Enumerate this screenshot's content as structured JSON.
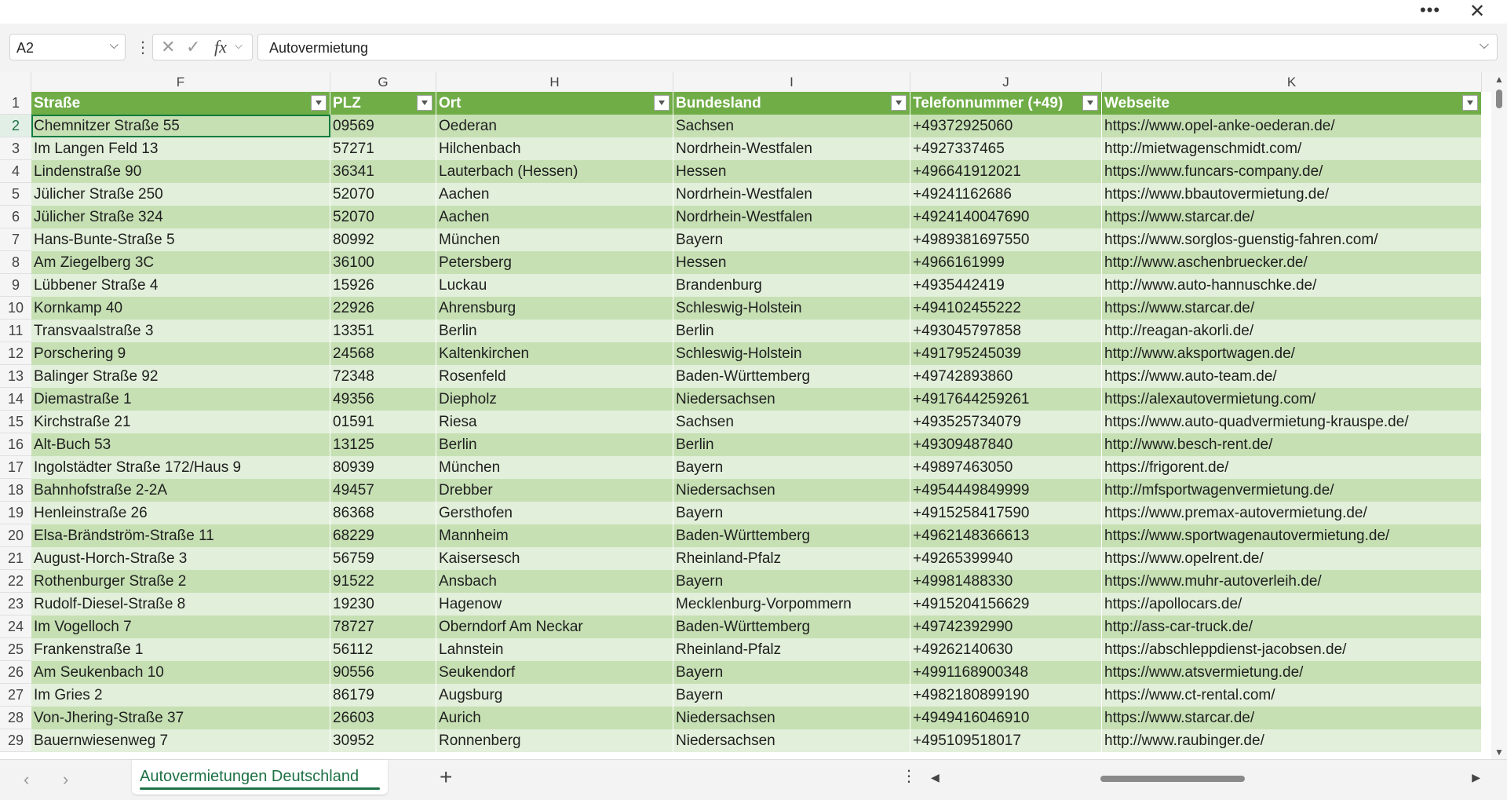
{
  "window": {
    "more_label": "•••",
    "close_label": "✕"
  },
  "formula_bar": {
    "name_box": "A2",
    "separator": "⋮",
    "cancel_icon": "✕",
    "enter_icon": "✓",
    "fx_label": "fx",
    "content": "Autovermietung"
  },
  "columns": [
    {
      "letter": "F",
      "header": "Straße"
    },
    {
      "letter": "G",
      "header": "PLZ"
    },
    {
      "letter": "H",
      "header": "Ort"
    },
    {
      "letter": "I",
      "header": "Bundesland"
    },
    {
      "letter": "J",
      "header": "Telefonnummer (+49)"
    },
    {
      "letter": "K",
      "header": "Webseite"
    }
  ],
  "header_row_number": "1",
  "rows": [
    {
      "n": "2",
      "cells": [
        "Chemnitzer Straße 55",
        "09569",
        "Oederan",
        "Sachsen",
        "+49372925060",
        "https://www.opel-anke-oederan.de/"
      ]
    },
    {
      "n": "3",
      "cells": [
        "Im Langen Feld 13",
        "57271",
        "Hilchenbach",
        "Nordrhein-Westfalen",
        "+4927337465",
        "http://mietwagenschmidt.com/"
      ]
    },
    {
      "n": "4",
      "cells": [
        "Lindenstraße 90",
        "36341",
        "Lauterbach (Hessen)",
        "Hessen",
        "+496641912021",
        "https://www.funcars-company.de/"
      ]
    },
    {
      "n": "5",
      "cells": [
        "Jülicher Straße 250",
        "52070",
        "Aachen",
        "Nordrhein-Westfalen",
        "+49241162686",
        "https://www.bbautovermietung.de/"
      ]
    },
    {
      "n": "6",
      "cells": [
        "Jülicher Straße 324",
        "52070",
        "Aachen",
        "Nordrhein-Westfalen",
        "+4924140047690",
        "https://www.starcar.de/"
      ]
    },
    {
      "n": "7",
      "cells": [
        "Hans-Bunte-Straße 5",
        "80992",
        "München",
        "Bayern",
        "+4989381697550",
        "https://www.sorglos-guenstig-fahren.com/"
      ]
    },
    {
      "n": "8",
      "cells": [
        "Am Ziegelberg 3C",
        "36100",
        "Petersberg",
        "Hessen",
        "+4966161999",
        "http://www.aschenbruecker.de/"
      ]
    },
    {
      "n": "9",
      "cells": [
        "Lübbener Straße 4",
        "15926",
        "Luckau",
        "Brandenburg",
        "+4935442419",
        "http://www.auto-hannuschke.de/"
      ]
    },
    {
      "n": "10",
      "cells": [
        "Kornkamp 40",
        "22926",
        "Ahrensburg",
        "Schleswig-Holstein",
        "+494102455222",
        "https://www.starcar.de/"
      ]
    },
    {
      "n": "11",
      "cells": [
        "Transvaalstraße 3",
        "13351",
        "Berlin",
        "Berlin",
        "+493045797858",
        "http://reagan-akorli.de/"
      ]
    },
    {
      "n": "12",
      "cells": [
        "Porschering 9",
        "24568",
        "Kaltenkirchen",
        "Schleswig-Holstein",
        "+491795245039",
        "http://www.aksportwagen.de/"
      ]
    },
    {
      "n": "13",
      "cells": [
        "Balinger Straße 92",
        "72348",
        "Rosenfeld",
        "Baden-Württemberg",
        "+49742893860",
        "https://www.auto-team.de/"
      ]
    },
    {
      "n": "14",
      "cells": [
        "Diemastraße 1",
        "49356",
        "Diepholz",
        "Niedersachsen",
        "+4917644259261",
        "https://alexautovermietung.com/"
      ]
    },
    {
      "n": "15",
      "cells": [
        "Kirchstraße 21",
        "01591",
        "Riesa",
        "Sachsen",
        "+493525734079",
        "https://www.auto-quadvermietung-krauspe.de/"
      ]
    },
    {
      "n": "16",
      "cells": [
        "Alt-Buch 53",
        "13125",
        "Berlin",
        "Berlin",
        "+49309487840",
        "http://www.besch-rent.de/"
      ]
    },
    {
      "n": "17",
      "cells": [
        "Ingolstädter Straße 172/Haus 9",
        "80939",
        "München",
        "Bayern",
        "+49897463050",
        "https://frigorent.de/"
      ]
    },
    {
      "n": "18",
      "cells": [
        "Bahnhofstraße 2-2A",
        "49457",
        "Drebber",
        "Niedersachsen",
        "+4954449849999",
        "http://mfsportwagenvermietung.de/"
      ]
    },
    {
      "n": "19",
      "cells": [
        "Henleinstraße 26",
        "86368",
        "Gersthofen",
        "Bayern",
        "+4915258417590",
        "https://www.premax-autovermietung.de/"
      ]
    },
    {
      "n": "20",
      "cells": [
        "Elsa-Brändström-Straße 11",
        "68229",
        "Mannheim",
        "Baden-Württemberg",
        "+4962148366613",
        "https://www.sportwagenautovermietung.de/"
      ]
    },
    {
      "n": "21",
      "cells": [
        "August-Horch-Straße 3",
        "56759",
        "Kaisersesch",
        "Rheinland-Pfalz",
        "+49265399940",
        "https://www.opelrent.de/"
      ]
    },
    {
      "n": "22",
      "cells": [
        "Rothenburger Straße 2",
        "91522",
        "Ansbach",
        "Bayern",
        "+49981488330",
        "https://www.muhr-autoverleih.de/"
      ]
    },
    {
      "n": "23",
      "cells": [
        "Rudolf-Diesel-Straße 8",
        "19230",
        "Hagenow",
        "Mecklenburg-Vorpommern",
        "+4915204156629",
        "https://apollocars.de/"
      ]
    },
    {
      "n": "24",
      "cells": [
        "Im Vogelloch 7",
        "78727",
        "Oberndorf Am Neckar",
        "Baden-Württemberg",
        "+49742392990",
        "http://ass-car-truck.de/"
      ]
    },
    {
      "n": "25",
      "cells": [
        "Frankenstraße 1",
        "56112",
        "Lahnstein",
        "Rheinland-Pfalz",
        "+49262140630",
        "https://abschleppdienst-jacobsen.de/"
      ]
    },
    {
      "n": "26",
      "cells": [
        "Am Seukenbach 10",
        "90556",
        "Seukendorf",
        "Bayern",
        "+4991168900348",
        "https://www.atsvermietung.de/"
      ]
    },
    {
      "n": "27",
      "cells": [
        "Im Gries 2",
        "86179",
        "Augsburg",
        "Bayern",
        "+4982180899190",
        "https://www.ct-rental.com/"
      ]
    },
    {
      "n": "28",
      "cells": [
        "Von-Jhering-Straße 37",
        "26603",
        "Aurich",
        "Niedersachsen",
        "+4949416046910",
        "https://www.starcar.de/"
      ]
    },
    {
      "n": "29",
      "cells": [
        "Bauernwiesenweg 7",
        "30952",
        "Ronnenberg",
        "Niedersachsen",
        "+495109518017",
        "http://www.raubinger.de/"
      ]
    }
  ],
  "sheet_bar": {
    "prev": "‹",
    "next": "›",
    "active_sheet": "Autovermietungen Deutschland",
    "add": "+",
    "more": "⋮",
    "scroll_left": "◀",
    "scroll_right": "▶"
  },
  "vscroll": {
    "up": "▲",
    "down": "▼"
  },
  "colors": {
    "header_fill": "#70ad47",
    "band_dark": "#c6e0b4",
    "band_light": "#e2efda",
    "accent": "#107c41"
  }
}
